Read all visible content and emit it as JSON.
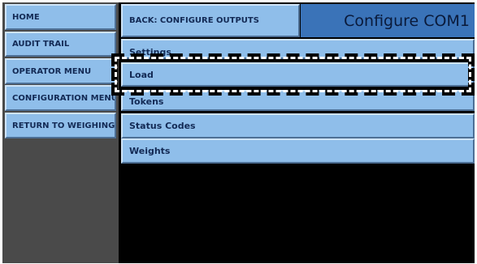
{
  "sidebar": {
    "items": [
      {
        "label": "HOME"
      },
      {
        "label": "AUDIT TRAIL"
      },
      {
        "label": "OPERATOR MENU"
      },
      {
        "label": "CONFIGURATION MENU"
      },
      {
        "label": "RETURN TO WEIGHING"
      }
    ]
  },
  "header": {
    "back_label": "BACK: CONFIGURE OUTPUTS",
    "title": "Configure COM1"
  },
  "menu": {
    "items": [
      {
        "label": "Settings"
      },
      {
        "label": "Load"
      },
      {
        "label": "Tokens"
      },
      {
        "label": "Status Codes"
      },
      {
        "label": "Weights"
      }
    ]
  },
  "colors": {
    "button": "#8fbeea",
    "title_bar": "#3a73b8",
    "sidebar_bg": "#4a4a4a",
    "content_bg": "#000000",
    "text": "#132a55"
  }
}
